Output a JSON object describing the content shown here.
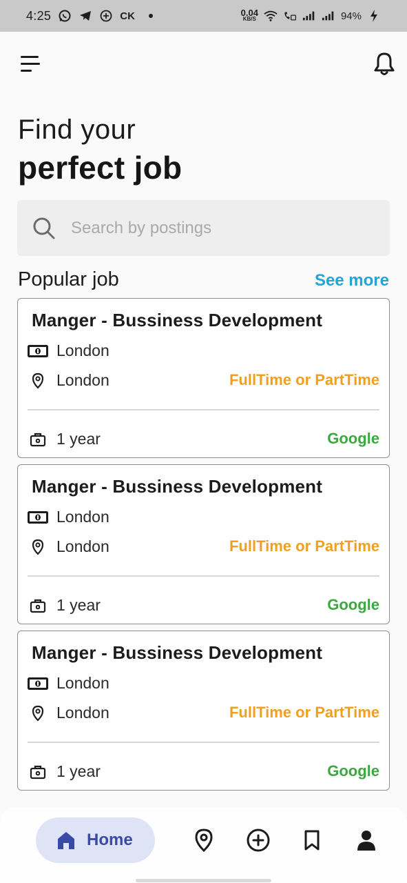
{
  "status_bar": {
    "time": "4:25",
    "carrier_label": "CK",
    "net_speed_value": "0.04",
    "net_speed_unit": "KB/S",
    "battery": "94%"
  },
  "header": {
    "title_line1": "Find your",
    "title_line2": "perfect job"
  },
  "search": {
    "placeholder": "Search by postings"
  },
  "popular": {
    "section_title": "Popular job",
    "see_more_label": "See more",
    "jobs": [
      {
        "title": "Manger - Bussiness Development",
        "salary": "London",
        "location": "London",
        "job_type": "FullTime or PartTime",
        "experience": "1 year",
        "company": "Google"
      },
      {
        "title": "Manger - Bussiness Development",
        "salary": "London",
        "location": "London",
        "job_type": "FullTime or PartTime",
        "experience": "1 year",
        "company": "Google"
      },
      {
        "title": "Manger - Bussiness Development",
        "salary": "London",
        "location": "London",
        "job_type": "FullTime or PartTime",
        "experience": "1 year",
        "company": "Google"
      }
    ]
  },
  "bottom_nav": {
    "home_label": "Home",
    "items": [
      "home-icon",
      "location-icon",
      "add-icon",
      "bookmark-icon",
      "profile-icon"
    ]
  },
  "colors": {
    "accent": "#21a5d6",
    "job_type": "#f0a020",
    "company": "#3da842",
    "nav_active_bg": "#dfe3f6",
    "nav_active_text": "#3a4aa6"
  }
}
